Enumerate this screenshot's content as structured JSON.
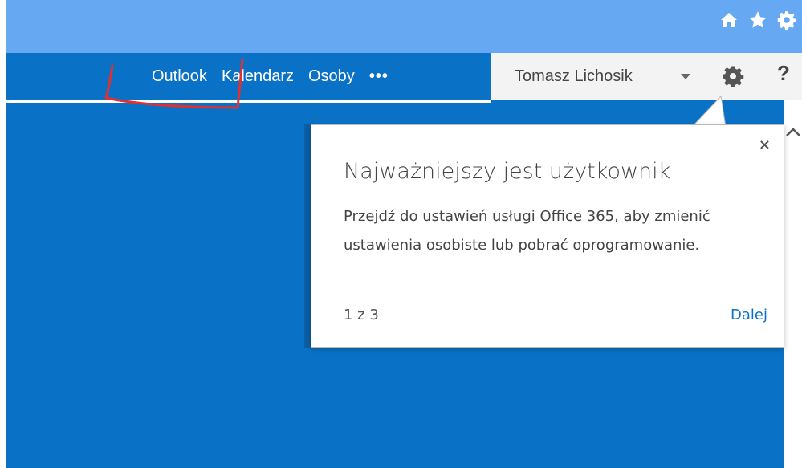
{
  "browser": {
    "icons": [
      "home-icon",
      "star-icon",
      "gear-icon"
    ]
  },
  "suite_bar": {
    "nav": [
      {
        "label": "Outlook"
      },
      {
        "label": "Kalendarz"
      },
      {
        "label": "Osoby"
      },
      {
        "label": "•••"
      }
    ],
    "user_name": "Tomasz Lichosik",
    "help_label": "?"
  },
  "callout": {
    "close_label": "×",
    "title": "Najważniejszy jest użytkownik",
    "body": "Przejdź do ustawień usługi Office 365, aby zmienić ustawienia osobiste lub pobrać oprogramowanie.",
    "page_indicator": "1 z 3",
    "next_label": "Dalej"
  },
  "colors": {
    "suite_blue": "#0a72c6",
    "browser_blue": "#66a8f2",
    "annotation_red": "#e03030"
  }
}
